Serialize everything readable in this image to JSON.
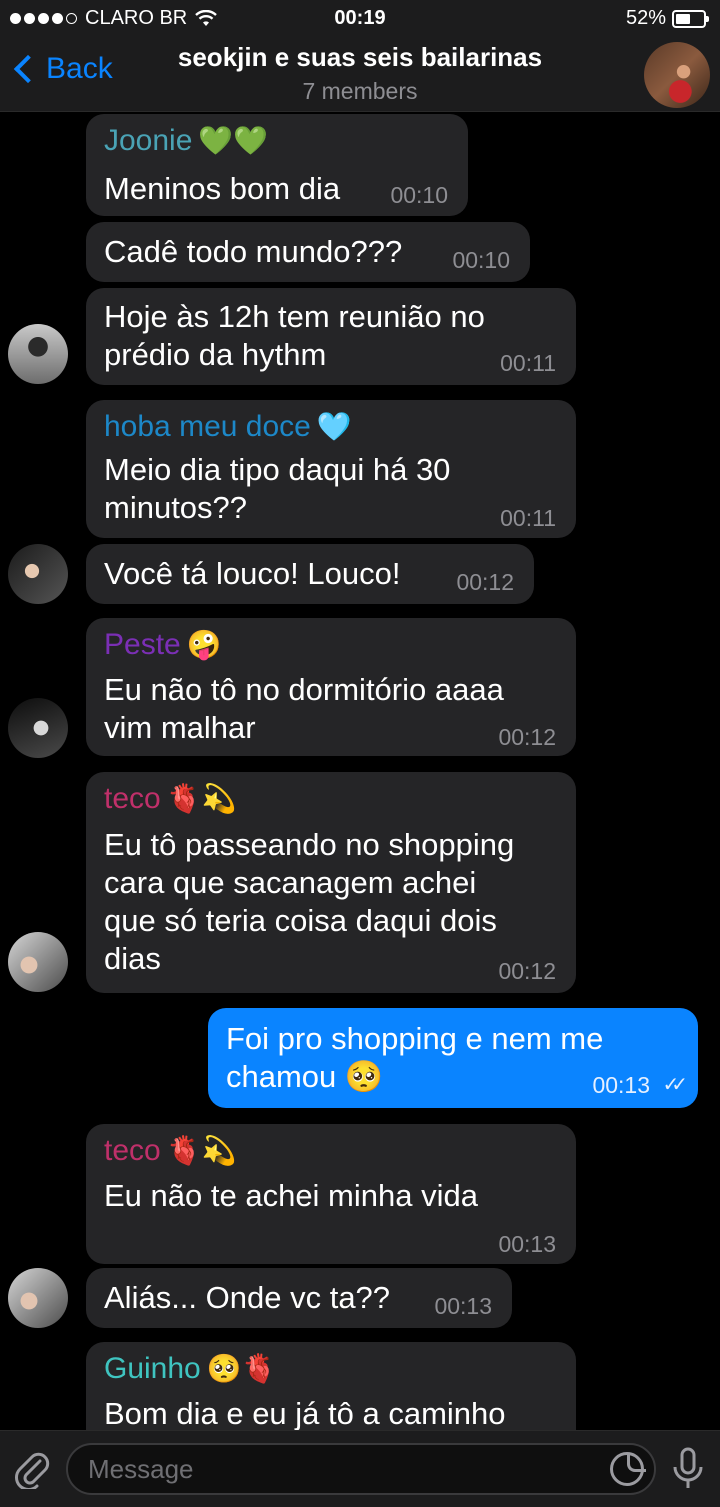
{
  "status": {
    "carrier": "CLARO BR",
    "time": "00:19",
    "battery": "52%"
  },
  "nav": {
    "back_label": "Back",
    "title": "seokjin e suas seis bailarinas",
    "subtitle": "7 members"
  },
  "messages": [
    {
      "sender": "Joonie",
      "sender_emoji": "💚💚",
      "sender_color": "#4aa3b5",
      "text": "Meninos bom dia",
      "time": "00:10"
    },
    {
      "text": "Cadê todo mundo???",
      "time": "00:10"
    },
    {
      "text": "Hoje às 12h tem reunião no\nprédio da hythm",
      "time": "00:11"
    },
    {
      "sender": "hoba meu doce",
      "sender_emoji": "🩵",
      "sender_color": "#1d88c8",
      "text": "Meio dia tipo daqui há 30\nminutos??",
      "time": "00:11"
    },
    {
      "text": "Você tá louco! Louco!",
      "time": "00:12"
    },
    {
      "sender": "Peste",
      "sender_emoji": "🤪",
      "sender_color": "#7b2fb5",
      "text": "Eu não tô no dormitório aaaa\nvim malhar",
      "time": "00:12"
    },
    {
      "sender": "teco",
      "sender_emoji": "🫀💫",
      "sender_color": "#c0306a",
      "text": "Eu tô passeando no shopping\ncara que sacanagem achei\nque só teria coisa daqui dois\ndias",
      "time": "00:12"
    },
    {
      "text": "Foi pro shopping e nem me\nchamou 🥺",
      "time": "00:13"
    },
    {
      "sender": "teco",
      "sender_emoji": "🫀💫",
      "sender_color": "#c0306a",
      "text": "Eu não te achei minha vida",
      "time": "00:13"
    },
    {
      "text": "Aliás... Onde vc ta??",
      "time": "00:13"
    },
    {
      "sender": "Guinho",
      "sender_emoji": "🥺🫀",
      "sender_color": "#3fc4c0",
      "text": "Bom dia e eu já tô a caminho",
      "time": ""
    }
  ],
  "input": {
    "placeholder": "Message"
  },
  "icons": {
    "attach": "paperclip-icon",
    "sticker": "sticker-icon",
    "mic": "microphone-icon"
  },
  "colors": {
    "accent": "#0a84ff",
    "bubble_in": "#252527",
    "bubble_out": "#0a84ff"
  }
}
